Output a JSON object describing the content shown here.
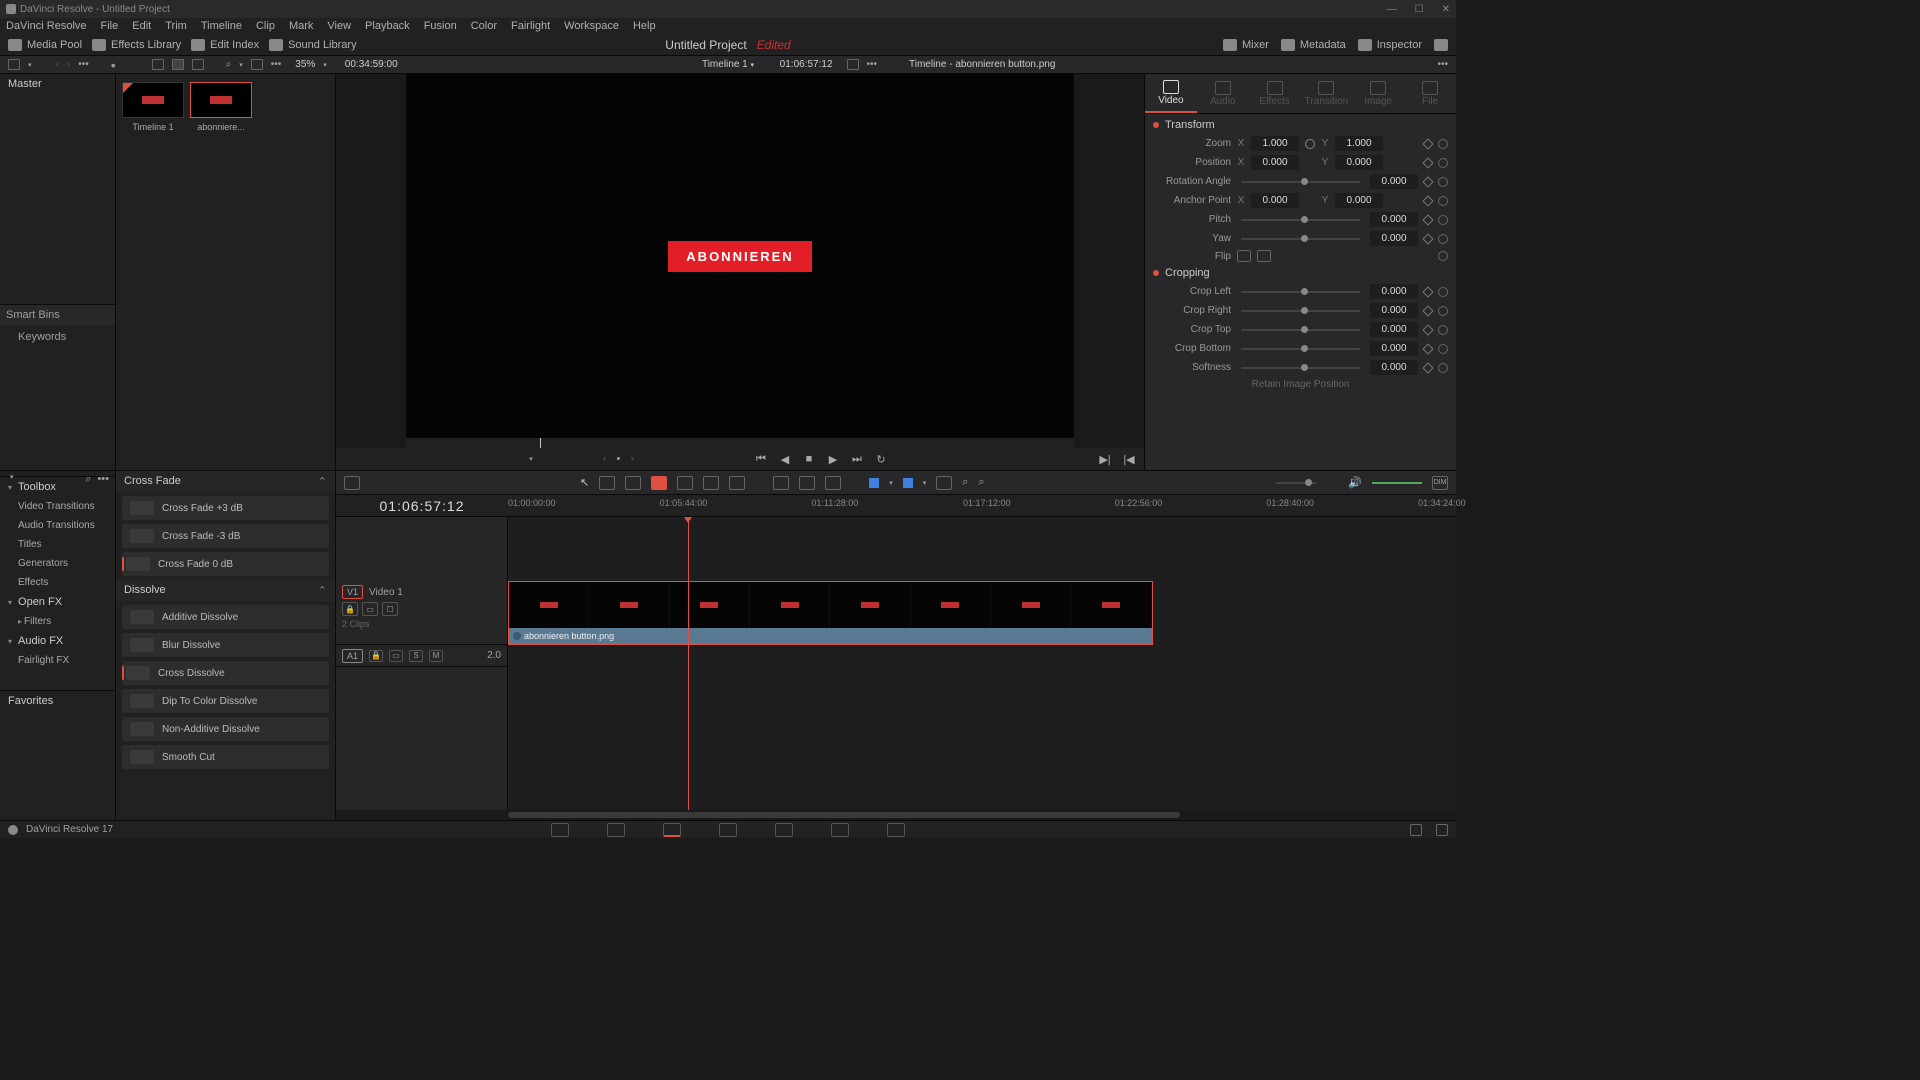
{
  "titlebar": {
    "app": "DaVinci Resolve",
    "doc": "Untitled Project"
  },
  "menus": [
    "DaVinci Resolve",
    "File",
    "Edit",
    "Trim",
    "Timeline",
    "Clip",
    "Mark",
    "View",
    "Playback",
    "Fusion",
    "Color",
    "Fairlight",
    "Workspace",
    "Help"
  ],
  "toptool": {
    "mediaPool": "Media Pool",
    "effectsLib": "Effects Library",
    "editIndex": "Edit Index",
    "soundLib": "Sound Library",
    "project": "Untitled Project",
    "edited": "Edited",
    "mixer": "Mixer",
    "metadata": "Metadata",
    "inspector": "Inspector"
  },
  "tool2": {
    "zoom": "35%",
    "srcTC": "00:34:59:00",
    "timelineName": "Timeline 1",
    "recTC": "01:06:57:12",
    "clipName": "Timeline - abonnieren button.png"
  },
  "pool": {
    "master": "Master",
    "smartBins": "Smart Bins",
    "keywords": "Keywords",
    "clips": [
      {
        "name": "Timeline 1",
        "selected": false
      },
      {
        "name": "abonniere...",
        "selected": true
      }
    ]
  },
  "viewer": {
    "button": "ABONNIEREN"
  },
  "fx": {
    "toolbox": "Toolbox",
    "nav": [
      "Video Transitions",
      "Audio Transitions",
      "Titles",
      "Generators",
      "Effects"
    ],
    "openfx": "Open FX",
    "filters": "Filters",
    "audiofx": "Audio FX",
    "fairlight": "Fairlight FX",
    "favorites": "Favorites",
    "cats": {
      "crossFade": "Cross Fade",
      "dissolve": "Dissolve"
    },
    "crossFadeItems": [
      "Cross Fade +3 dB",
      "Cross Fade -3 dB",
      "Cross Fade 0 dB"
    ],
    "dissolveItems": [
      "Additive Dissolve",
      "Blur Dissolve",
      "Cross Dissolve",
      "Dip To Color Dissolve",
      "Non-Additive Dissolve",
      "Smooth Cut"
    ]
  },
  "inspector": {
    "tabs": [
      "Video",
      "Audio",
      "Effects",
      "Transition",
      "Image",
      "File"
    ],
    "transform": "Transform",
    "cropping": "Cropping",
    "zoom": {
      "label": "Zoom",
      "x": "1.000",
      "y": "1.000"
    },
    "position": {
      "label": "Position",
      "x": "0.000",
      "y": "0.000"
    },
    "rotation": {
      "label": "Rotation Angle",
      "v": "0.000"
    },
    "anchor": {
      "label": "Anchor Point",
      "x": "0.000",
      "y": "0.000"
    },
    "pitch": {
      "label": "Pitch",
      "v": "0.000"
    },
    "yaw": {
      "label": "Yaw",
      "v": "0.000"
    },
    "flip": {
      "label": "Flip"
    },
    "cropL": {
      "label": "Crop Left",
      "v": "0.000"
    },
    "cropR": {
      "label": "Crop Right",
      "v": "0.000"
    },
    "cropT": {
      "label": "Crop Top",
      "v": "0.000"
    },
    "cropB": {
      "label": "Crop Bottom",
      "v": "0.000"
    },
    "soft": {
      "label": "Softness",
      "v": "0.000"
    },
    "retain": "Retain Image Position"
  },
  "timeline": {
    "bigtc": "01:06:57:12",
    "ticks": [
      "01:00:00:00",
      "01:05:44:00",
      "01:11:28:00",
      "01:17:12:00",
      "01:22:56:00",
      "01:28:40:00",
      "01:34:24:00"
    ],
    "v1": {
      "tag": "V1",
      "name": "Video 1",
      "clips": "2 Clips"
    },
    "a1": {
      "tag": "A1",
      "val": "2.0"
    },
    "clipLabel": "abonnieren button.png"
  },
  "bottom": {
    "app": "DaVinci Resolve 17"
  }
}
